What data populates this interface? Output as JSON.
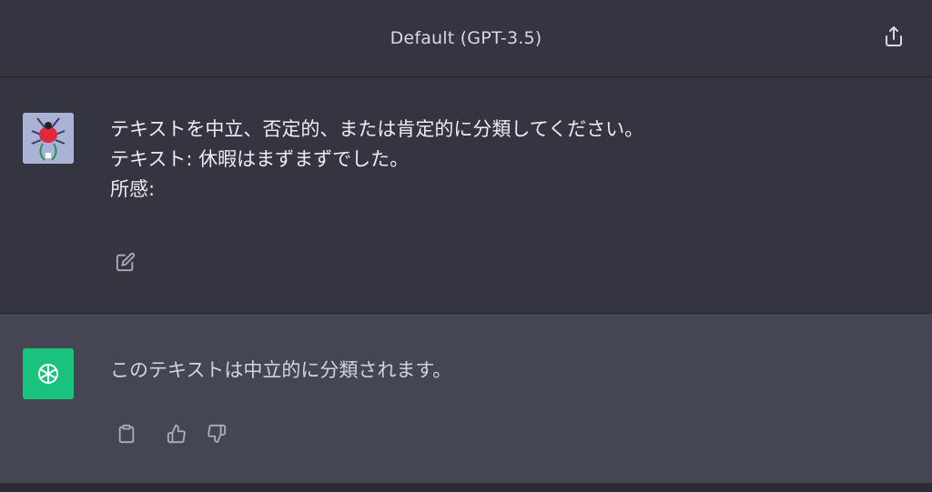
{
  "header": {
    "title": "Default (GPT-3.5)"
  },
  "icons": {
    "share": "share-icon",
    "edit": "edit-icon",
    "copy": "clipboard-icon",
    "thumbs_up": "thumbs-up-icon",
    "thumbs_down": "thumbs-down-icon",
    "assistant_logo": "openai-logo-icon"
  },
  "conversation": {
    "user_message": {
      "lines": [
        "テキストを中立、否定的、または肯定的に分類してください。",
        "テキスト: 休暇はまずまずでした。",
        "所感:"
      ]
    },
    "assistant_message": {
      "text": "このテキストは中立的に分類されます。"
    }
  },
  "colors": {
    "background": "#343541",
    "assistant_background": "#444654",
    "assistant_avatar": "#19c37d",
    "text": "#ececf1"
  }
}
